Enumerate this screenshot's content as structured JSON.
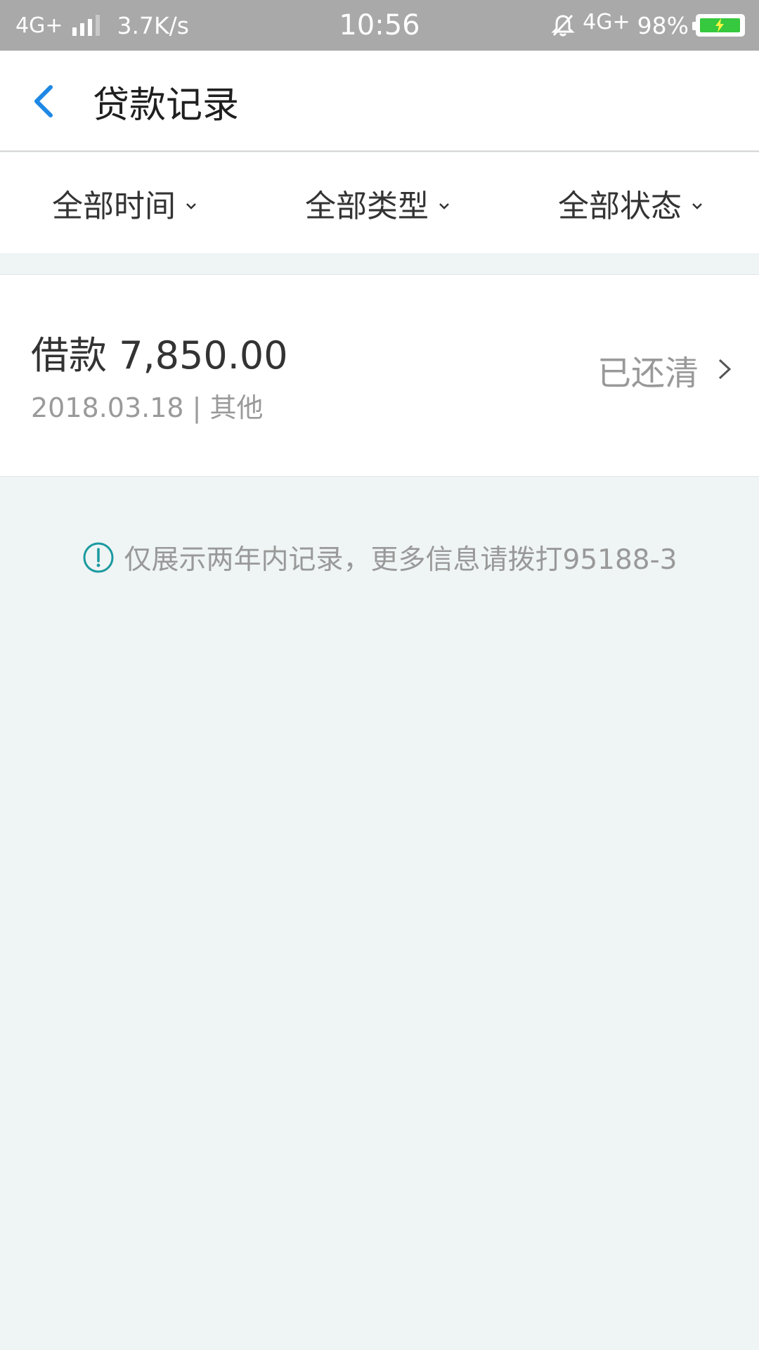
{
  "status_bar": {
    "network_left": "4G+",
    "speed": "3.7K/s",
    "time": "10:56",
    "network_right": "4G+",
    "battery_percent": "98%",
    "battery_level": 0.98,
    "battery_color": "#36c83e"
  },
  "header": {
    "title": "贷款记录",
    "back_icon": "chevron-left-icon",
    "accent_color": "#1e88e5"
  },
  "filters": [
    {
      "label": "全部时间",
      "icon": "chevron-down-icon"
    },
    {
      "label": "全部类型",
      "icon": "chevron-down-icon"
    },
    {
      "label": "全部状态",
      "icon": "chevron-down-icon"
    }
  ],
  "records": [
    {
      "amount": "借款 7,850.00",
      "meta": "2018.03.18 | 其他",
      "status": "已还清",
      "icon": "chevron-right-icon"
    }
  ],
  "notice": {
    "icon": "info-circle-icon",
    "text": "仅展示两年内记录，更多信息请拨打95188-3",
    "icon_color": "#1a9aa0"
  }
}
